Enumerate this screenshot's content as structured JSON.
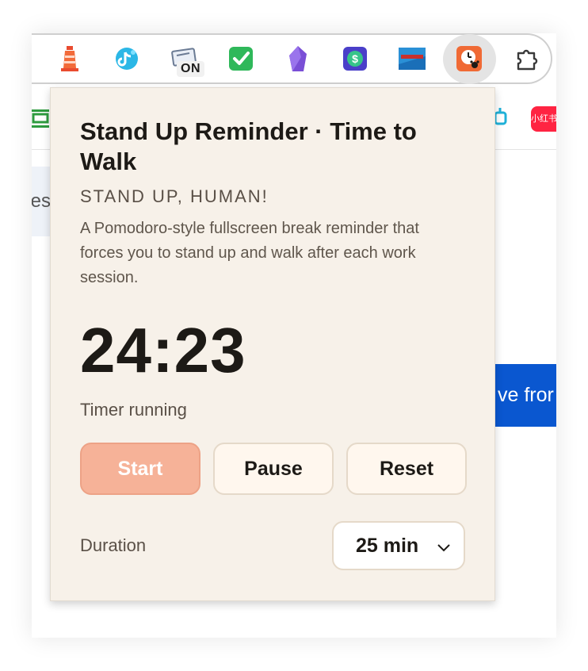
{
  "browser": {
    "toolbar": {
      "extensions": [
        {
          "name": "lighthouse-icon"
        },
        {
          "name": "tiktok-icon"
        },
        {
          "name": "screen-icon",
          "badge": "ON"
        },
        {
          "name": "checkmark-icon"
        },
        {
          "name": "crystal-icon"
        },
        {
          "name": "dollar-icon"
        },
        {
          "name": "flag-icon"
        },
        {
          "name": "stand-up-reminder-icon"
        },
        {
          "name": "puzzle-icon"
        }
      ]
    },
    "bookmarks": {
      "red_label": "小红书"
    },
    "background": {
      "side_text": "es",
      "cta_text": "ve fror"
    }
  },
  "popup": {
    "title": "Stand Up Reminder · Time to Walk",
    "subtitle": "STAND UP, HUMAN!",
    "description": "A Pomodoro-style fullscreen break reminder that forces you to stand up and walk after each work session.",
    "timer": "24:23",
    "status": "Timer running",
    "buttons": {
      "start": "Start",
      "pause": "Pause",
      "reset": "Reset"
    },
    "duration": {
      "label": "Duration",
      "selected": "25 min"
    }
  },
  "colors": {
    "popup_bg": "#f7f1e9",
    "start_button": "#f6b298",
    "accent_orange": "#f06a35",
    "cta_blue": "#0a57d0"
  }
}
